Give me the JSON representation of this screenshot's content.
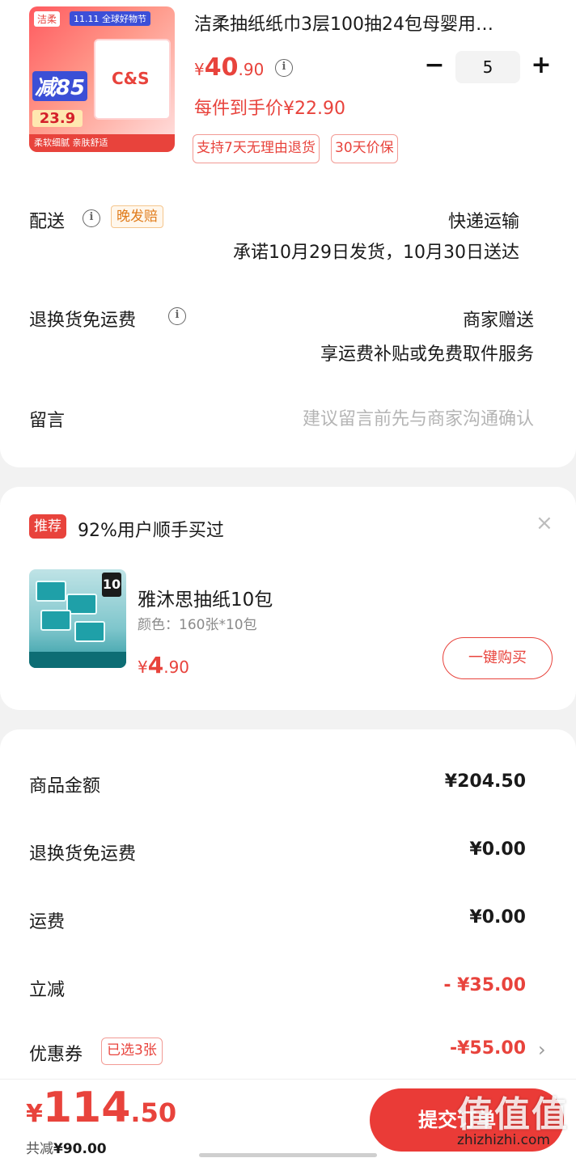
{
  "product": {
    "image_texts": {
      "brand_tag": "洁柔",
      "event_tag": "11.11 全球好物节",
      "promo": "减85",
      "promo_price": "23.9",
      "bottom_strip": "柔软细腻 亲肤舒适"
    },
    "title": "洁柔抽纸纸巾3层100抽24包母婴用…",
    "price_currency": "¥",
    "price_int": "40",
    "price_dec": ".90",
    "quantity": "5",
    "minus_label": "−",
    "plus_label": "+",
    "unit_price_text": "每件到手价¥22.90",
    "badges": [
      "支持7天无理由退货",
      "30天价保"
    ]
  },
  "delivery": {
    "label": "配送",
    "late_badge": "晚发赔",
    "method": "快递运输",
    "promise": "承诺10月29日发货，10月30日送达"
  },
  "return_shipping": {
    "label": "退换货免运费",
    "value": "商家赠送",
    "detail": "享运费补贴或免费取件服务"
  },
  "message": {
    "label": "留言",
    "placeholder": "建议留言前先与商家沟通确认"
  },
  "recommend": {
    "badge": "推荐",
    "text": "92%用户顺手买过",
    "close": "×",
    "item_name": "雅沐思抽纸10包",
    "item_color": "颜色：160张*10包",
    "price_currency": "¥",
    "price_int": "4",
    "price_dec": ".90",
    "buy_label": "一键购买",
    "image_text": "10"
  },
  "summary": {
    "goods_amount_label": "商品金额",
    "goods_amount": "¥204.50",
    "return_fee_label": "退换货免运费",
    "return_fee": "¥0.00",
    "shipping_label": "运费",
    "shipping": "¥0.00",
    "instant_discount_label": "立减",
    "instant_discount": "- ¥35.00",
    "coupon_label": "优惠券",
    "coupon_badge": "已选3张",
    "coupon_value": "-¥55.00",
    "chevron": "›"
  },
  "bottom": {
    "total_currency": "¥",
    "total_int": "114",
    "total_dec": ".50",
    "saved_prefix": "共减",
    "saved_value": "¥90.00",
    "submit_label": "提交订单",
    "watermark": "值值值",
    "watermark_url": "zhizhizhi.com"
  },
  "colors": {
    "accent": "#e8433c",
    "submit": "#ea3b37",
    "background": "#f2f2f2"
  }
}
